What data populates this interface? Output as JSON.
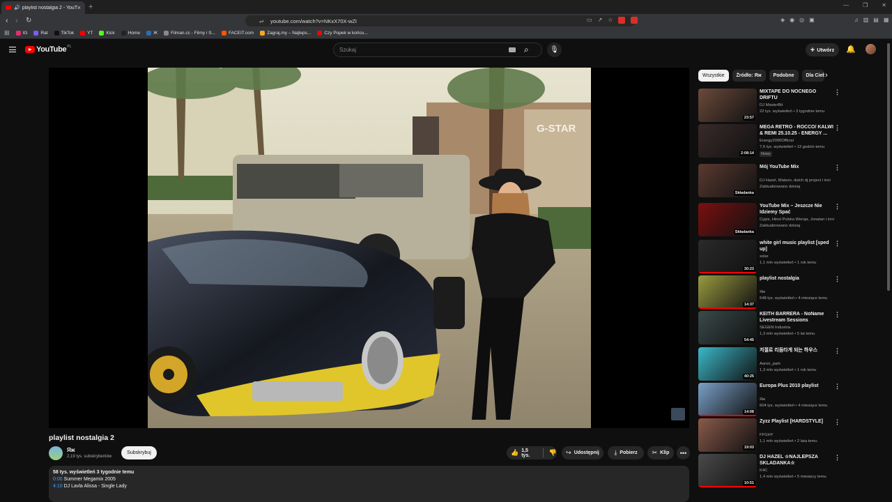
{
  "browser": {
    "tab_title": "playlist nostalgia 2 - YouTube",
    "url": "youtube.com/watch?v=NKxX70X-wZI",
    "bookmarks": [
      {
        "label": "IG",
        "color": "#e1306c"
      },
      {
        "label": "Rat",
        "color": "#7b5cff"
      },
      {
        "label": "TikTok",
        "color": "#111111"
      },
      {
        "label": "YT",
        "color": "#ff0000"
      },
      {
        "label": "Kick",
        "color": "#53fc18"
      },
      {
        "label": "Home",
        "color": "#222222"
      },
      {
        "label": "Ж",
        "color": "#2b6cb0"
      },
      {
        "label": "Filman.cc - Filmy i S...",
        "color": "#888888"
      },
      {
        "label": "FACEIT.com",
        "color": "#ff5500"
      },
      {
        "label": "Zagraj.my – Najleps...",
        "color": "#f5a623"
      },
      {
        "label": "Czy Popek w końcu...",
        "color": "#ff0000"
      }
    ]
  },
  "header": {
    "logo_text": "YouTube",
    "logo_region": "PL",
    "search_placeholder": "Szukaj",
    "create_label": "Utwórz"
  },
  "video": {
    "title": "playlist nostalgia 2",
    "channel": "Яж",
    "subscribers": "2,19 tys. subskrybentów",
    "subscribe_label": "Subskrybuj",
    "likes": "1,5 tys.",
    "share_label": "Udostępnij",
    "download_label": "Pobierz",
    "clip_label": "Klip",
    "description": {
      "meta": "58 tys. wyświetleń  3 tygodnie temu",
      "lines": [
        {
          "ts": "0:00",
          "text": "Summer Megamix 2005"
        },
        {
          "ts": "4:10",
          "text": "DJ Lavla Alissa - Single Lady"
        }
      ]
    }
  },
  "chips": [
    "Wszystkie",
    "Źródło: Яж",
    "Podobne",
    "Dla Ciebie"
  ],
  "recommendations": [
    {
      "title": "MIXTAPE DO NOCNEGO DRIFTU",
      "channel": "DJ MasterBit",
      "views": "22 tys. wyświetleń • 3 tygodnie temu",
      "duration": "23:57",
      "badge": "",
      "thumb_color": "#6b4a3a",
      "progress": 0
    },
    {
      "title": "MEGA RETRO - ROCCO/ KALWI & REMI 25.10.25 - ENERGY ...",
      "channel": "Energy2000Official",
      "views": "7,6 tys. wyświetleń • 13 godzin temu",
      "duration": "2:08:14",
      "badge": "Nowy",
      "thumb_color": "#3a2a2a",
      "progress": 0
    },
    {
      "title": "Mój YouTube Mix",
      "channel": "DJ Hazel, Matson, dutch dj project i inni",
      "views": "Zaktualizowano dzisiaj",
      "duration": "Składanka",
      "badge": "",
      "thumb_color": "#5a3a30",
      "progress": 0
    },
    {
      "title": "YouTube Mix – Jeszcze Nie Idziemy Spać",
      "channel": "Cypis, Hinol Polska Wersja, Jonatan i inni",
      "views": "Zaktualizowano dzisiaj",
      "duration": "Składanka",
      "badge": "",
      "thumb_color": "#7a1010",
      "progress": 0
    },
    {
      "title": "white girl music playlist [sped up]",
      "channel": "solar",
      "views": "1,1 mln wyświetleń • 1 rok temu",
      "duration": "30:23",
      "badge": "",
      "thumb_color": "#2a2a2a",
      "progress": 1
    },
    {
      "title": "playlist nostalgia",
      "channel": "Яж",
      "views": "548 tys. wyświetleń • 4 miesiące temu",
      "duration": "14:37",
      "badge": "",
      "thumb_color": "#9a9a40",
      "progress": 1
    },
    {
      "title": "KEITH BARRERA - NoName Livestream Sessions",
      "channel": "SEGEN Industria",
      "views": "1,3 mln wyświetleń • 5 lat temu",
      "duration": "54:45",
      "badge": "",
      "thumb_color": "#3a4a4a",
      "progress": 0
    },
    {
      "title": "저절로 리듬타게 되는 하우스",
      "channel": "Aaron_park",
      "views": "1,3 mln wyświetleń • 1 rok temu",
      "duration": "40:25",
      "badge": "",
      "thumb_color": "#3ab8c8",
      "progress": 0
    },
    {
      "title": "Europa Plus 2010 playlist",
      "channel": "Яж",
      "views": "604 tys. wyświetleń • 4 miesiące temu",
      "duration": "14:08",
      "badge": "",
      "thumb_color": "#7aa0c8",
      "progress": 1
    },
    {
      "title": "Zyzz Playlist [HARDSTYLE]",
      "channel": "FFGHY",
      "views": "1,1 mln wyświetleń • 2 lata temu",
      "duration": "19:03",
      "badge": "",
      "thumb_color": "#8a5a4a",
      "progress": 0
    },
    {
      "title": "DJ HAZEL ☆NAJLEPSZA SKLADANKA☆",
      "channel": "K4C",
      "views": "1,4 mln wyświetleń • 5 miesięcy temu",
      "duration": "10:51",
      "badge": "",
      "thumb_color": "#4a4a4a",
      "progress": 1
    }
  ]
}
